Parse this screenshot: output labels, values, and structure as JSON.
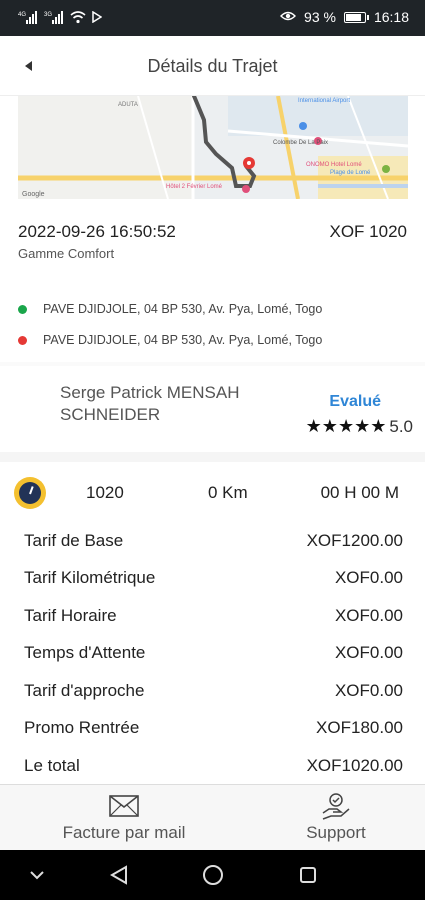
{
  "status_bar": {
    "signal_left": "4G",
    "signal_right": "3G",
    "battery_percent_text": "93 %",
    "battery_level": 0.93,
    "time": "16:18"
  },
  "header": {
    "title": "Détails du Trajet"
  },
  "map": {
    "labels": [
      "ADUTA",
      "International Airport",
      "Colombe De La Paix",
      "ONOMO Hotel Lomé",
      "Plage de Lomé",
      "Hôtel 2 Février Lomé",
      "Google"
    ]
  },
  "trip": {
    "datetime": "2022-09-26 16:50:52",
    "price": "XOF 1020",
    "range": "Gamme Comfort",
    "pickup": "PAVE DJIDJOLE, 04 BP 530, Av. Pya, Lomé, Togo",
    "dropoff": "PAVE DJIDJOLE, 04 BP 530, Av. Pya, Lomé, Togo",
    "colors": {
      "pickup": "#1aa64b",
      "dropoff": "#e53935"
    }
  },
  "driver": {
    "name": "Serge Patrick MENSAH SCHNEIDER",
    "status": "Evalué",
    "stars": "★★★★★",
    "rating": "5.0"
  },
  "summary": {
    "amount": "1020",
    "distance": "0 Km",
    "duration": "00 H 00 M"
  },
  "fares": [
    {
      "label": "Tarif de Base",
      "value": "XOF1200.00"
    },
    {
      "label": "Tarif Kilométrique",
      "value": "XOF0.00"
    },
    {
      "label": "Tarif Horaire",
      "value": "XOF0.00"
    },
    {
      "label": "Temps d'Attente",
      "value": "XOF0.00"
    },
    {
      "label": "Tarif d'approche",
      "value": "XOF0.00"
    },
    {
      "label": "Promo Rentrée",
      "value": "XOF180.00"
    },
    {
      "label": "Le total",
      "value": "XOF1020.00"
    }
  ],
  "bottom": {
    "invoice_label": "Facture par mail",
    "support_label": "Support"
  },
  "icons": {
    "back": "back-arrow-icon",
    "invoice": "mail-icon",
    "support": "support-hand-icon",
    "gauge": "speedometer-icon"
  }
}
